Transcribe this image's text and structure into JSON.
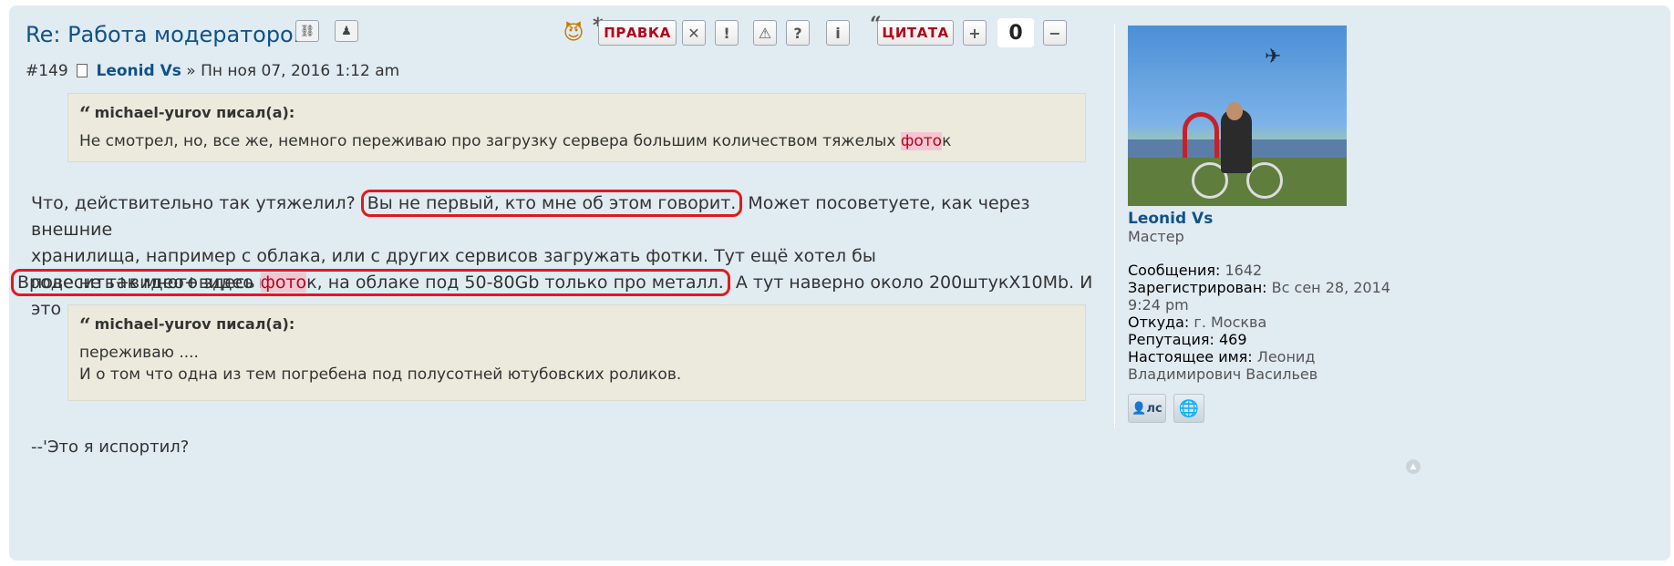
{
  "post": {
    "title": "Re: Работа модераторов.",
    "number": "#149",
    "author": "Leonid Vs",
    "separator": "»",
    "date": "Пн ноя 07, 2016 1:12 am"
  },
  "toolbar": {
    "edit_label": "ПРАВКА",
    "quote_label": "ЦИТАТА",
    "score": "0",
    "plus": "+",
    "minus": "−"
  },
  "quote1": {
    "cite": "michael-yurov писал(а):",
    "text_before": "Не смотрел, но, все же, немного переживаю про загрузку сервера большим количеством тяжелых ",
    "highlight": "фото",
    "text_after": "к"
  },
  "body": {
    "line1_before": "Что, действительно так утяжелил? ",
    "line1_boxed": "Вы не первый, кто мне об этом говорит.",
    "line1_after": " Может посоветуете, как через внешние",
    "line2": "хранилища, например с облака, или с других сервисов загружать фотки. Тут ещё хотел бы повесить+видео+видео как",
    "line3": "это делалось",
    "line4_boxed_before": "Вроде не так много здесь ",
    "line4_highlight": "фото",
    "line4_boxed_after": "к, на облаке под 50-80Gb только про металл.",
    "line4_after": " А тут наверно около 200штукX10Mb. И"
  },
  "quote2": {
    "cite": "michael-yurov писал(а):",
    "line1": "переживаю ....",
    "line2": "И о том что одна из тем погребена под полусотней ютубовских роликов."
  },
  "signature": "--'Это я испортил?",
  "profile": {
    "name": "Leonid Vs",
    "rank": "Мастер",
    "posts_label": "Сообщения:",
    "posts_value": "1642",
    "registered_label": "Зарегистрирован:",
    "registered_value": "Вс сен 28, 2014 9:24 pm",
    "location_label": "Откуда:",
    "location_value": "г. Москва",
    "reputation_label": "Репутация:",
    "reputation_value": "469",
    "realname_label": "Настоящее имя:",
    "realname_value": "Леонид Владимирович Васильев",
    "pm_label": "лс"
  },
  "colors": {
    "post_bg": "#e1ebf2",
    "quote_bg": "#ebeadd",
    "link": "#105289",
    "highlight_bg": "#f7c5d2",
    "annotation_red": "#e01a1a"
  },
  "icons": [
    "link-icon",
    "user-icon",
    "devil-emoji-icon",
    "delete-icon",
    "warn-icon",
    "report-icon",
    "question-icon",
    "info-icon",
    "file-icon",
    "globe-icon",
    "back-to-top-icon"
  ]
}
